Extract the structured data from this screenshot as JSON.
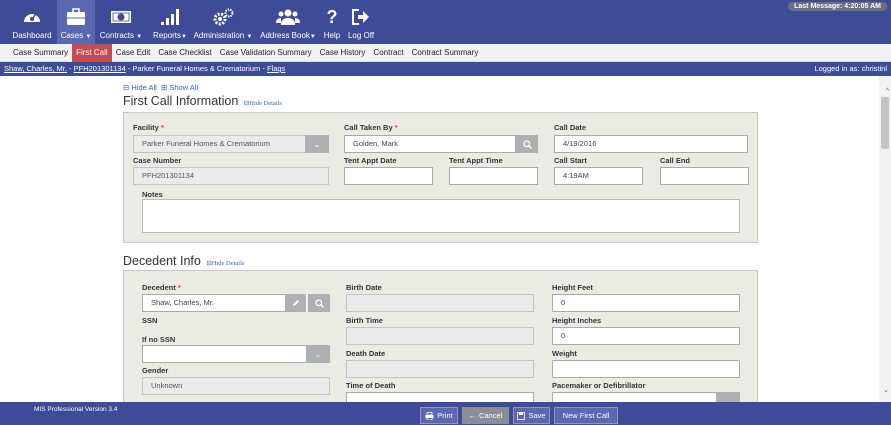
{
  "nav": {
    "items": [
      {
        "label": "Dashboard",
        "icon": "dashboard-icon"
      },
      {
        "label": "Cases",
        "icon": "briefcase-icon"
      },
      {
        "label": "Contracts",
        "icon": "money-icon"
      },
      {
        "label": "Reports",
        "icon": "bar-chart-icon"
      },
      {
        "label": "Administration",
        "icon": "gears-icon"
      },
      {
        "label": "Address Book",
        "icon": "users-icon"
      },
      {
        "label": "Help",
        "icon": "question-icon"
      },
      {
        "label": "Log Off",
        "icon": "logout-icon"
      }
    ],
    "last_message": "Last Message: 4:20:05 AM"
  },
  "subtabs": [
    "Case Summary",
    "First Call",
    "Case Edit",
    "Case Checklist",
    "Case Validation Summary",
    "Case History",
    "Contract",
    "Contract Summary"
  ],
  "breadcrumb": {
    "person": "Shaw, Charles, Mr.",
    "case_number": "PFH201301134",
    "facility": "Parker Funeral Homes & Crematorium",
    "flags": "Flags",
    "logged_in": "Logged in as: christinl"
  },
  "toggles": {
    "hide_all": "Hide All",
    "show_all": "Show All"
  },
  "first_call": {
    "title": "First Call Information",
    "hide_details": "Hide Details",
    "facility_label": "Facility",
    "facility_value": "Parker Funeral Homes & Crematorium",
    "call_taken_by_label": "Call Taken By",
    "call_taken_by_value": "Golden, Mark",
    "call_date_label": "Call Date",
    "call_date_value": "4/19/2016",
    "case_number_label": "Case Number",
    "case_number_value": "PFH201301134",
    "tent_appt_date_label": "Tent Appt Date",
    "tent_appt_time_label": "Tent Appt Time",
    "call_start_label": "Call Start",
    "call_start_value": "4:19AM",
    "call_end_label": "Call End",
    "notes_label": "Notes"
  },
  "decedent": {
    "title": "Decedent Info",
    "hide_details": "Hide Details",
    "decedent_label": "Decedent",
    "decedent_value": "Shaw, Charles, Mr.",
    "birth_date_label": "Birth Date",
    "height_feet_label": "Height Feet",
    "height_feet_value": "0",
    "ssn_label": "SSN",
    "birth_time_label": "Birth Time",
    "height_inches_label": "Height Inches",
    "height_inches_value": "0",
    "if_no_ssn_label": "If no SSN",
    "death_date_label": "Death Date",
    "weight_label": "Weight",
    "gender_label": "Gender",
    "gender_value": "Unknown",
    "time_of_death_label": "Time of Death",
    "pacemaker_label": "Pacemaker or Defibrillator"
  },
  "footer": {
    "version": "MIS Professional Version 3.4",
    "print": "Print",
    "cancel": "Cancel",
    "save": "Save",
    "new_first_call": "New First Call"
  },
  "colors": {
    "nav": "#3e4c98",
    "active_tab": "#c14d4f",
    "panel": "#ebebe6",
    "link": "#3e62b0"
  }
}
